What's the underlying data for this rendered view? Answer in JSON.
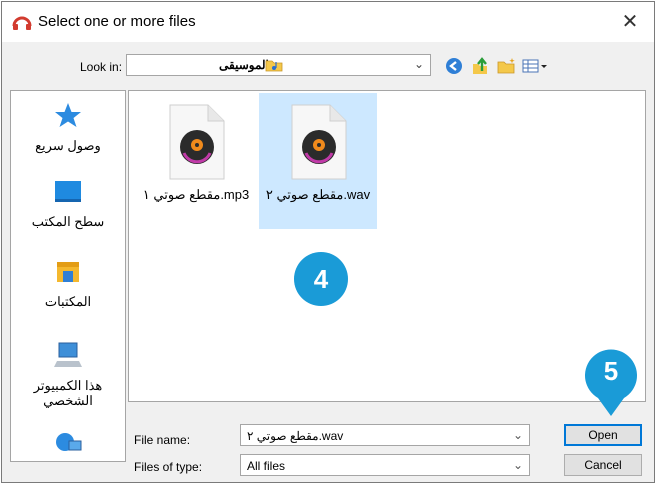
{
  "window": {
    "title": "Select one or more files",
    "close_glyph": "✕"
  },
  "lookin": {
    "label": "Look in:",
    "value": "الموسيقى"
  },
  "toolbar": {
    "icons": [
      "back-icon",
      "up-folder-icon",
      "new-folder-icon",
      "view-menu-icon"
    ]
  },
  "sidebar": {
    "items": [
      {
        "label": "وصول سريع",
        "icon": "quick-access-icon"
      },
      {
        "label": "سطح المكتب",
        "icon": "desktop-icon"
      },
      {
        "label": "المكتبات",
        "icon": "libraries-icon"
      },
      {
        "label": "هذا الكمبيوتر الشخصي",
        "icon": "this-pc-icon"
      },
      {
        "label": "",
        "icon": "network-icon"
      }
    ]
  },
  "files": [
    {
      "name": "مقطع صوتي ١.mp3",
      "selected": false
    },
    {
      "name": "مقطع صوتي ٢.wav",
      "selected": true
    }
  ],
  "badges": {
    "step4": "4",
    "step5": "5"
  },
  "filename": {
    "label": "File name:",
    "value": "مقطع صوتي ٢.wav"
  },
  "filetype": {
    "label": "Files of type:",
    "value": "All files"
  },
  "buttons": {
    "open": "Open",
    "cancel": "Cancel"
  },
  "colors": {
    "accent": "#1a9bd7",
    "selection": "#cde8ff"
  }
}
